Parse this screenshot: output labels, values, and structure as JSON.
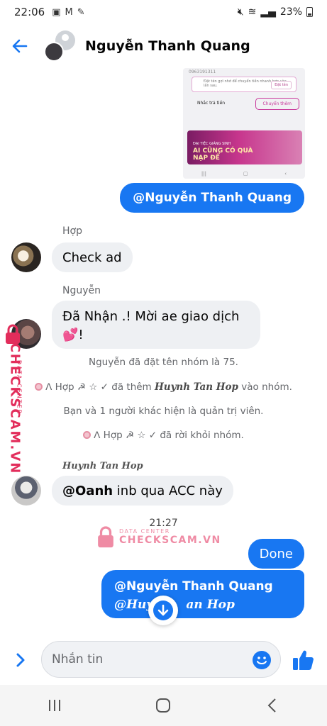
{
  "status_bar": {
    "time": "22:06",
    "battery": "23%"
  },
  "header": {
    "title": "Nguyễn Thanh Quang"
  },
  "screenshot_preview": {
    "phone": "0963191311",
    "card_text": "Đặt tên gợi nhớ để chuyển tiền nhanh hơn vào lần sau.",
    "card_button": "Đặt tên",
    "btn_remind": "Nhắc trả tiền",
    "btn_transfer": "Chuyển thêm",
    "banner_small": "ĐẠI TIỆC GIÁNG SINH",
    "banner_line1": "AI CŨNG CÓ QUÀ",
    "banner_line2": "NẠP ĐỂ"
  },
  "messages": {
    "out_mention": "@Nguyễn Thanh Quang",
    "hop_sender": "Hợp",
    "hop_text": "Check ad",
    "nguyen_sender": "Nguyễn",
    "nguyen_text_1": "Đã Nhận .! Mời ae giao dịch",
    "nguyen_text_2": "💕!",
    "sys_1": "Nguyễn đã đặt tên nhóm là 75.",
    "sys_2_prefix": "ᐱ Hợp ☭ ☆ ✓ đã thêm",
    "sys_2_name": "Huynh Tan Hop",
    "sys_2_suffix": "vào nhóm.",
    "sys_3": "Bạn và 1 người khác hiện là quản trị viên.",
    "sys_4": "ᐱ Hợp ☭ ☆ ✓ đã rời khỏi nhóm.",
    "huynh_sender": "Huynh Tan Hop",
    "huynh_mention": "@Oanh",
    "huynh_text": " inb qua ACC này",
    "timestamp": "21:27",
    "done": "Done",
    "multi_line1": "@Nguyễn Thanh Quang",
    "multi_line2_a": "@Huy",
    "multi_line2_b": "an Hop"
  },
  "watermark": {
    "sub": "DATA CENTER",
    "main": "CHECKSCAM.VN"
  },
  "composer": {
    "placeholder": "Nhắn tin"
  },
  "colors": {
    "accent": "#1877f2",
    "bubble_in": "#eef0f3",
    "watermark": "#e22d5b"
  },
  "icons": [
    "back-arrow-icon",
    "expand-icon",
    "emoji-icon",
    "like-icon",
    "scroll-down-icon",
    "recents-icon",
    "home-icon",
    "nav-back-icon"
  ]
}
